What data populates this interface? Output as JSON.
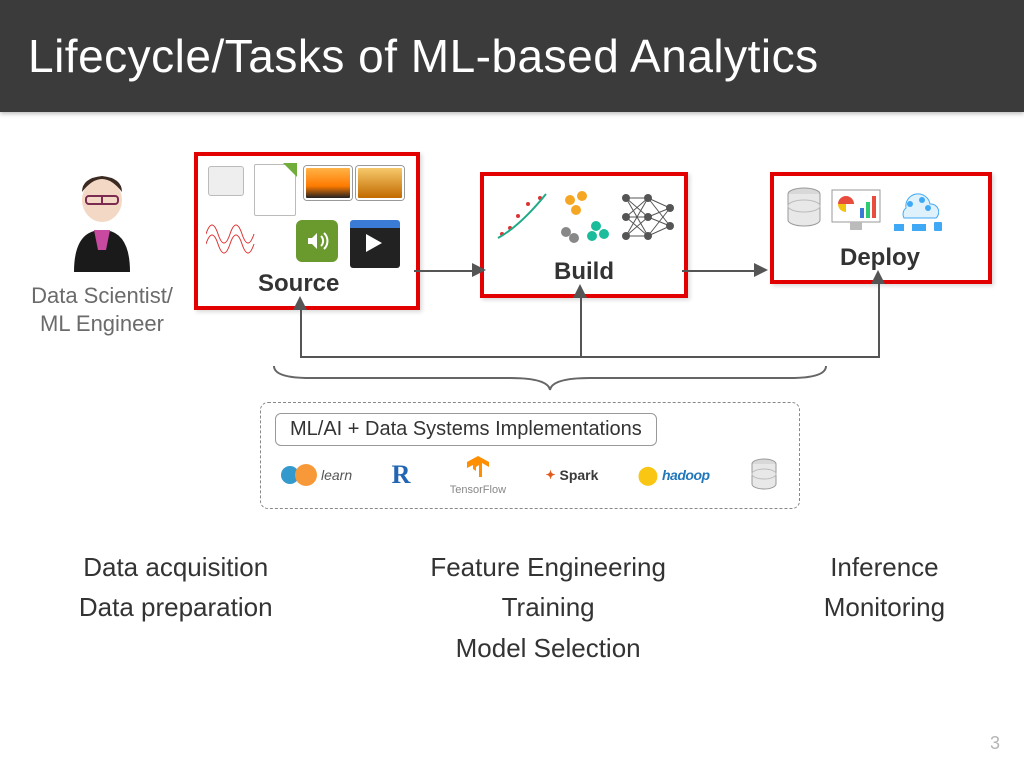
{
  "title": "Lifecycle/Tasks of ML-based Analytics",
  "role_label": "Data Scientist/\nML Engineer",
  "stages": {
    "source": "Source",
    "build": "Build",
    "deploy": "Deploy"
  },
  "implementations": {
    "caption": "ML/AI + Data Systems Implementations",
    "tools": [
      "learn",
      "R",
      "TensorFlow",
      "Spark",
      "hadoop",
      "DB"
    ]
  },
  "task_columns": {
    "source": [
      "Data acquisition",
      "Data preparation"
    ],
    "build": [
      "Feature Engineering",
      "Training",
      "Model Selection"
    ],
    "deploy": [
      "Inference",
      "Monitoring"
    ]
  },
  "page_number": "3"
}
